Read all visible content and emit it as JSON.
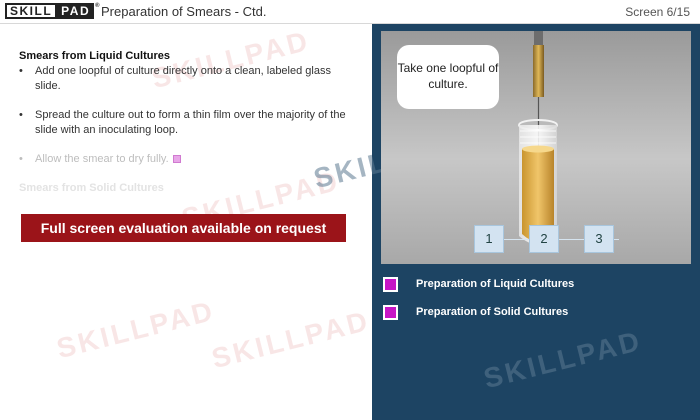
{
  "header": {
    "logo_left": "SKILL",
    "logo_right": "PAD",
    "logo_tm": "®",
    "title": "Preparation of Smears - Ctd.",
    "screen": "Screen 6/15"
  },
  "content": {
    "section_title": "Smears from Liquid Cultures",
    "bullet_glyph": "•",
    "bullets": [
      "Add one loopful of culture directly onto a clean, labeled glass slide.",
      "Spread the culture out to form a thin film over the majority of the slide with an inoculating loop.",
      "Allow the smear to dry fully."
    ],
    "next_section_title": "Smears from Solid Cultures",
    "eval_banner": "Full screen evaluation available on request"
  },
  "watermark_text": "SKILLPAD",
  "panel": {
    "bubble_text": "Take one loopful of culture.",
    "steps": [
      "1",
      "2",
      "3"
    ],
    "nav": [
      "Preparation of Liquid Cultures",
      "Preparation of Solid Cultures"
    ]
  },
  "colors": {
    "panel_bg": "#1d4463",
    "banner_red": "#9b1419",
    "nav_square": "#c615c6",
    "step_button": "#d3e3f1"
  },
  "icons": {
    "nav_square": "magenta-square-icon",
    "inline_marker": "pink-square-icon"
  }
}
